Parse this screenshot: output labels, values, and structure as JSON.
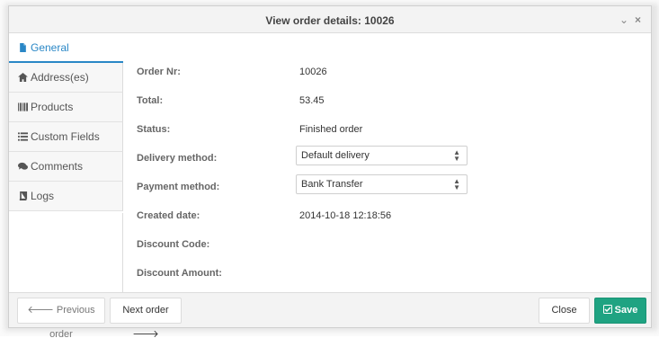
{
  "window": {
    "title": "View order details: 10026",
    "collapse_glyph": "⌄",
    "close_glyph": "×"
  },
  "sidebar": {
    "items": [
      {
        "label": "General",
        "icon": "file-icon"
      },
      {
        "label": "Address(es)",
        "icon": "home-icon"
      },
      {
        "label": "Products",
        "icon": "barcode-icon"
      },
      {
        "label": "Custom Fields",
        "icon": "list-icon"
      },
      {
        "label": "Comments",
        "icon": "comments-icon"
      },
      {
        "label": "Logs",
        "icon": "book-icon"
      }
    ]
  },
  "details": {
    "order_nr_label": "Order Nr:",
    "order_nr": "10026",
    "total_label": "Total:",
    "total": "53.45",
    "status_label": "Status:",
    "status": "Finished order",
    "delivery_label": "Delivery method:",
    "delivery": "Default delivery",
    "payment_label": "Payment method:",
    "payment": "Bank Transfer",
    "created_label": "Created date:",
    "created": "2014-10-18 12:18:56",
    "discount_code_label": "Discount Code:",
    "discount_amount_label": "Discount Amount:"
  },
  "footer": {
    "prev_label": "Previous order",
    "next_label": "Next order",
    "close_label": "Close",
    "save_label": "Save"
  },
  "colors": {
    "accent": "#2a87c6",
    "save": "#1fa382"
  }
}
